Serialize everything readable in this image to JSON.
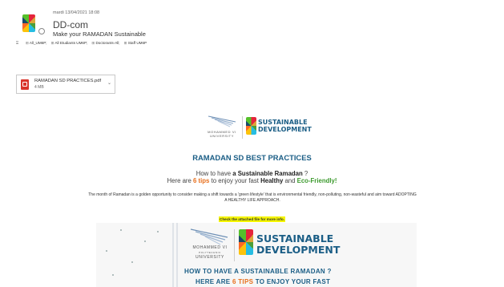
{
  "email": {
    "date": "mardi 13/04/2021 18:08",
    "sender": "DD-com",
    "subject": "Make your RAMADAN Sustainable",
    "recipients": [
      "All_UM6P;",
      "All Etudiants UM6P;",
      "Doctorants-All;",
      "Staff UM6P"
    ]
  },
  "attachment": {
    "name": "RAMADAN SD PRACTICES.pdf",
    "size": "4 MB"
  },
  "body": {
    "logo_univ_line1": "MOHAMMED VI",
    "logo_univ_line2": "UNIVERSITY",
    "logo_sd_line1": "SUSTAINABLE",
    "logo_sd_line2": "DEVELOPMENT",
    "heading": "RAMADAN SD BEST PRACTICES",
    "line1_a": "How to have ",
    "line1_b": "a Sustainable Ramadan",
    "line1_c": " ?",
    "line2_a": "Here are ",
    "line2_b": "6 tips",
    "line2_c": " to enjoy your fast ",
    "line2_d": "Healthy",
    "line2_e": " and ",
    "line2_f": "Eco-Friendly!",
    "paragraph": "The month of Ramadan is a golden opportunity to consider making a shift towards a 'green lifestyle' that is environmental friendly, non-polluting, non-wasteful and aim toward ADOPTING A HEALTHY LIFE APPROACH.",
    "note": "Check the attached file for more info."
  },
  "banner": {
    "univ_line1": "MOHAMMED VI",
    "univ_line2": "POLYTECHNIC",
    "univ_line3": "UNIVERSITY",
    "sd_line1": "SUSTAINABLE",
    "sd_line2": "DEVELOPMENT",
    "q1_a": "HOW TO HAVE A ",
    "q1_b": "SUSTAINABLE RAMADAN",
    "q1_c": " ?",
    "q2_a": "HERE ARE ",
    "q2_b": "6 TIPS",
    "q2_c": " TO ENJOY YOUR FAST"
  },
  "colors": {
    "brand_blue": "#1b5e86",
    "tips_orange": "#e86f1c",
    "eco_green": "#3c9a2d",
    "note_highlight": "#f5f500"
  }
}
